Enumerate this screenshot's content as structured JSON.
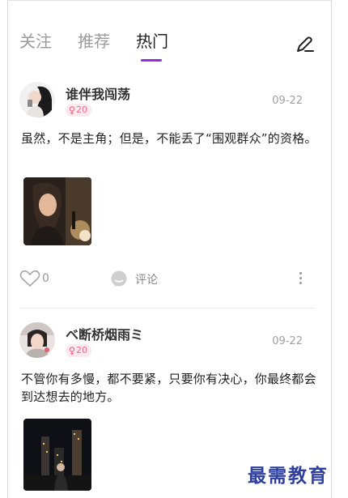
{
  "tabs": [
    {
      "label": "关注",
      "active": false
    },
    {
      "label": "推荐",
      "active": false
    },
    {
      "label": "热门",
      "active": true
    }
  ],
  "accent_color": "#9b28e0",
  "posts": [
    {
      "username": "谁伴我闯荡",
      "badge": "20",
      "badge_icon": "female-icon",
      "date": "09-22",
      "text": "虽然，不是主角；但是，不能丢了“围观群众”的资格。",
      "likes": "0",
      "comment_label": "评论"
    },
    {
      "username": "ベ断桥烟雨ミ",
      "badge": "20",
      "badge_icon": "female-icon",
      "date": "09-22",
      "text": "不管你有多慢，都不要紧，只要你有决心，你最终都会到达想去的地方。"
    }
  ],
  "watermark": "最需教育"
}
